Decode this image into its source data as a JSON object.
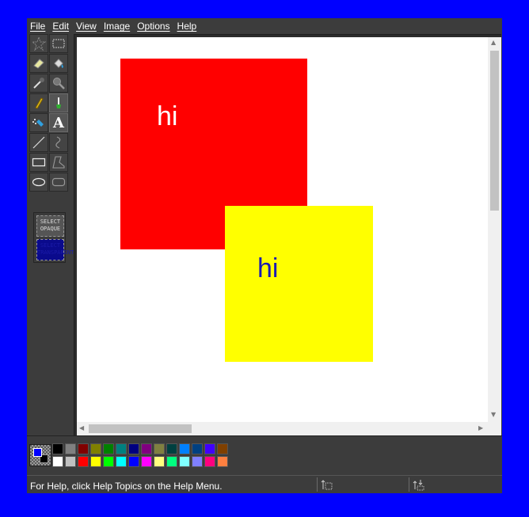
{
  "menu": {
    "items": [
      "File",
      "Edit",
      "View",
      "Image",
      "Options",
      "Help"
    ]
  },
  "toolbox": {
    "tools": [
      {
        "name": "free-form-select-icon"
      },
      {
        "name": "rect-select-icon"
      },
      {
        "name": "eraser-icon"
      },
      {
        "name": "fill-icon"
      },
      {
        "name": "pick-color-icon"
      },
      {
        "name": "magnifier-icon"
      },
      {
        "name": "pencil-icon"
      },
      {
        "name": "brush-icon"
      },
      {
        "name": "airbrush-icon"
      },
      {
        "name": "text-icon",
        "glyph": "A",
        "active": true
      },
      {
        "name": "line-icon"
      },
      {
        "name": "curve-icon"
      },
      {
        "name": "rectangle-icon"
      },
      {
        "name": "polygon-icon"
      },
      {
        "name": "ellipse-icon"
      },
      {
        "name": "rounded-rectangle-icon"
      }
    ],
    "options": {
      "opaque_label": "SELECT OPAQUE",
      "transparent_label": "SELECT TRANSPARENT"
    }
  },
  "canvas": {
    "background": "#ffffff",
    "shapes": [
      {
        "color": "#ff0000",
        "text": "hi",
        "text_color": "#ffffff"
      },
      {
        "color": "#ffff00",
        "text": "hi",
        "text_color": "#1a1ab4"
      }
    ]
  },
  "palette": {
    "foreground": "#0000ff",
    "background": "#000000",
    "colors_row1": [
      "#000000",
      "#808080",
      "#800000",
      "#808000",
      "#008000",
      "#008080",
      "#000080",
      "#800080",
      "#808040",
      "#004040",
      "#0080ff",
      "#004080",
      "#4000ff",
      "#804000"
    ],
    "colors_row2": [
      "#ffffff",
      "#c0c0c0",
      "#ff0000",
      "#ffff00",
      "#00ff00",
      "#00ffff",
      "#0000ff",
      "#ff00ff",
      "#ffff80",
      "#00ff80",
      "#80ffff",
      "#8080ff",
      "#ff0080",
      "#ff8040"
    ]
  },
  "status": {
    "help_text": "For Help, click Help Topics on the Help Menu."
  }
}
